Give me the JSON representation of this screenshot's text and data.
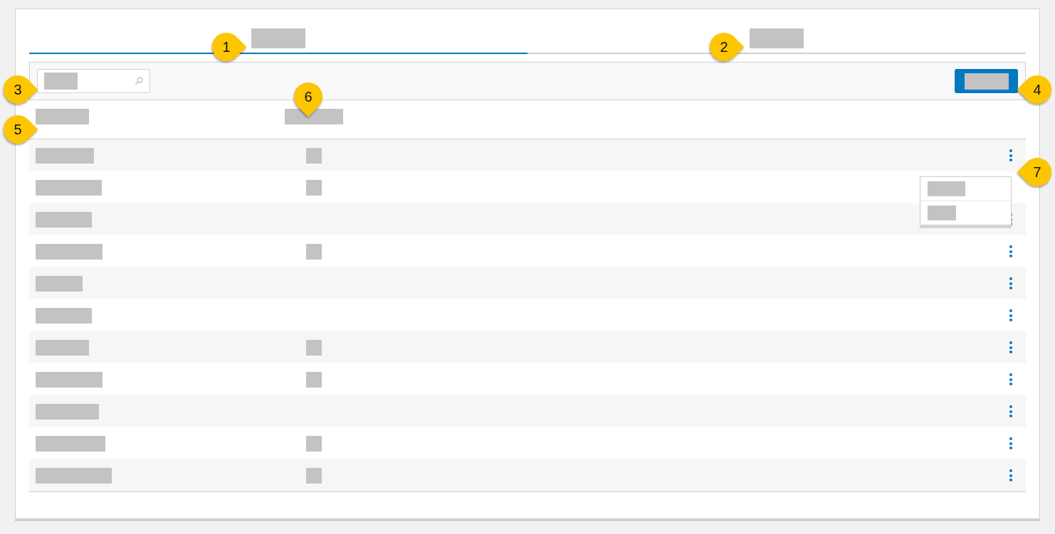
{
  "tabs": [
    {
      "kind": "redacted",
      "selected": true
    },
    {
      "kind": "redacted",
      "selected": false
    }
  ],
  "search": {
    "kind": "redacted"
  },
  "primary_button": {
    "kind": "redacted"
  },
  "table": {
    "columns": [
      {
        "kind": "redacted"
      },
      {
        "kind": "redacted"
      }
    ],
    "rows": [
      {
        "name": {
          "kind": "redacted"
        },
        "value": {
          "kind": "redacted"
        },
        "actions": true,
        "menu_open": true
      },
      {
        "name": {
          "kind": "redacted"
        },
        "value": {
          "kind": "redacted"
        },
        "actions": false,
        "menu_open": false
      },
      {
        "name": {
          "kind": "redacted"
        },
        "actions": true,
        "menu_open": false
      },
      {
        "name": {
          "kind": "redacted"
        },
        "value": {
          "kind": "redacted"
        },
        "actions": true,
        "menu_open": false
      },
      {
        "name": {
          "kind": "redacted"
        },
        "actions": true,
        "menu_open": false
      },
      {
        "name": {
          "kind": "redacted"
        },
        "actions": true,
        "menu_open": false
      },
      {
        "name": {
          "kind": "redacted"
        },
        "value": {
          "kind": "redacted"
        },
        "actions": true,
        "menu_open": false
      },
      {
        "name": {
          "kind": "redacted"
        },
        "value": {
          "kind": "redacted"
        },
        "actions": true,
        "menu_open": false
      },
      {
        "name": {
          "kind": "redacted"
        },
        "actions": true,
        "menu_open": false
      },
      {
        "name": {
          "kind": "redacted"
        },
        "value": {
          "kind": "redacted"
        },
        "actions": true,
        "menu_open": false
      },
      {
        "name": {
          "kind": "redacted"
        },
        "value": {
          "kind": "redacted"
        },
        "actions": true,
        "menu_open": false
      }
    ]
  },
  "row_menu": {
    "items": [
      {
        "kind": "redacted"
      },
      {
        "kind": "redacted"
      }
    ]
  },
  "callouts": [
    {
      "number": "1",
      "kind": "rightward"
    },
    {
      "number": "2",
      "kind": "rightward"
    },
    {
      "number": "3",
      "kind": "rightward"
    },
    {
      "number": "4",
      "kind": "leftward"
    },
    {
      "number": "5",
      "kind": "rightward"
    },
    {
      "number": "6",
      "kind": "downward"
    },
    {
      "number": "7",
      "kind": "leftward"
    }
  ]
}
